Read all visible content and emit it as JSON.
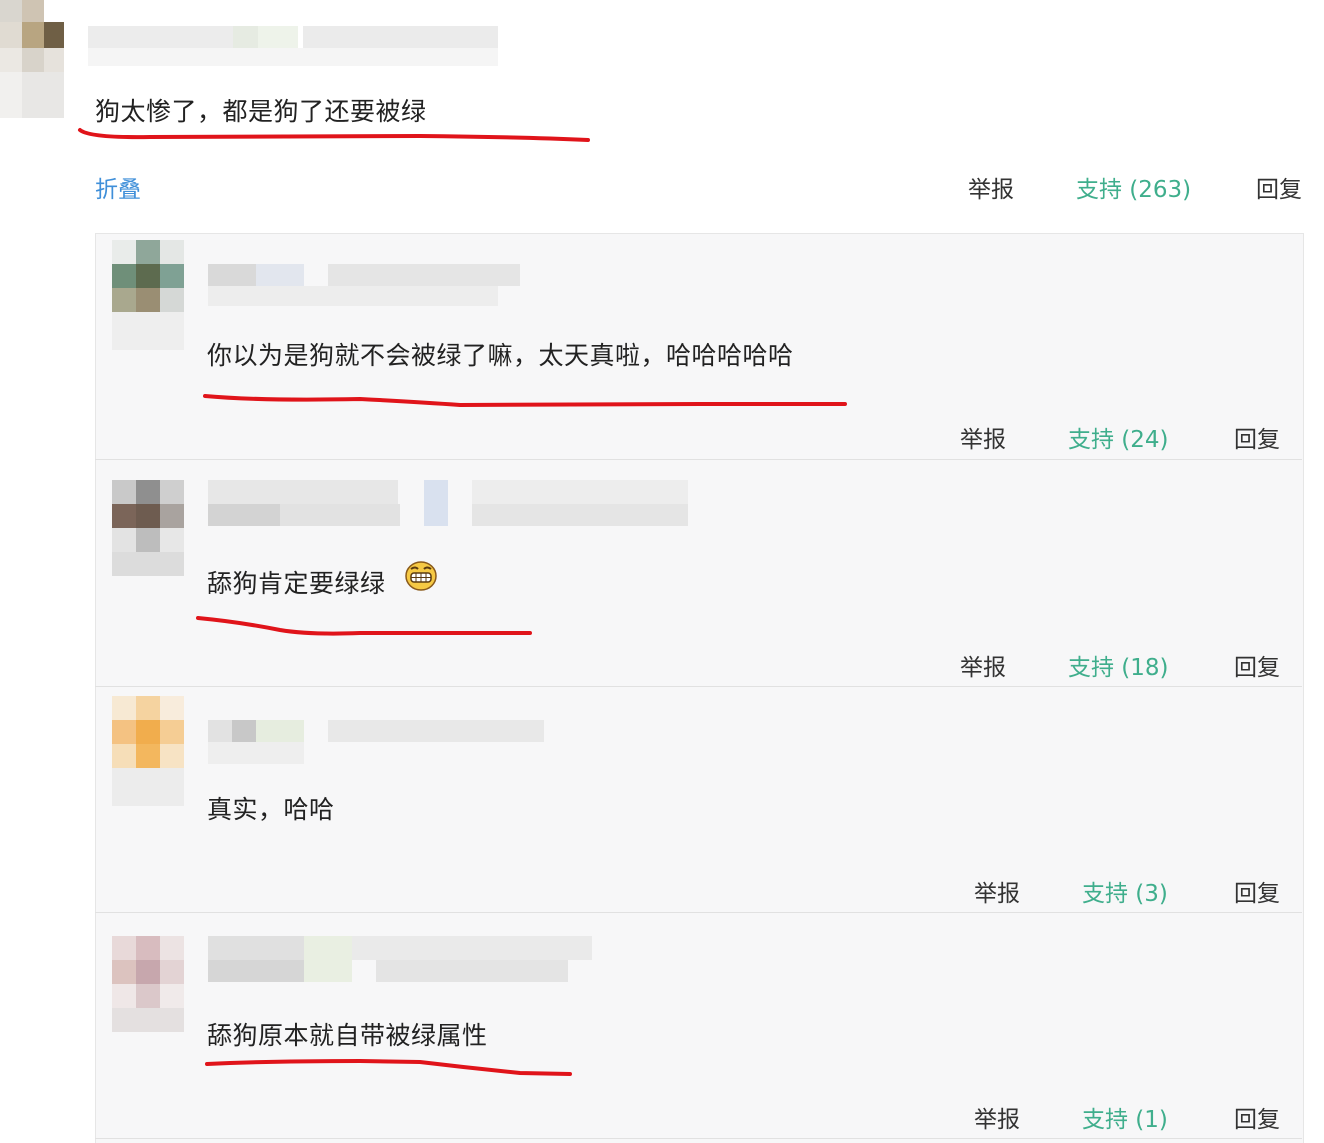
{
  "top_comment": {
    "text": "狗太惨了，都是狗了还要被绿",
    "fold_label": "折叠",
    "report_label": "举报",
    "support_label": "支持 (263)",
    "reply_label": "回复"
  },
  "replies": [
    {
      "text": "你以为是狗就不会被绿了嘛，太天真啦，哈哈哈哈哈",
      "report_label": "举报",
      "support_label": "支持 (24)",
      "reply_label": "回复"
    },
    {
      "text": "舔狗肯定要绿绿",
      "emoji": "grinning-emoji",
      "report_label": "举报",
      "support_label": "支持 (18)",
      "reply_label": "回复"
    },
    {
      "text": "真实，哈哈",
      "report_label": "举报",
      "support_label": "支持 (3)",
      "reply_label": "回复"
    },
    {
      "text": "舔狗原本就自带被绿属性",
      "report_label": "举报",
      "support_label": "支持 (1)",
      "reply_label": "回复"
    }
  ],
  "colors": {
    "support": "#3fae8c",
    "fold": "#3f8fd9",
    "underline": "#e0141a",
    "reply_bg": "#f7f7f8"
  }
}
